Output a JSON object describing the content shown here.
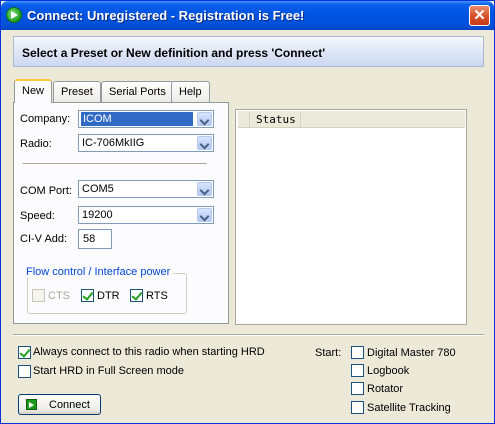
{
  "window": {
    "title": "Connect: Unregistered - Registration is Free!",
    "close_glyph": "✕",
    "icon": "green-arrow-icon"
  },
  "banner": {
    "text": "Select a Preset or New definition and press 'Connect'"
  },
  "tabs": [
    {
      "label": "New",
      "active": true
    },
    {
      "label": "Preset",
      "active": false
    },
    {
      "label": "Serial Ports",
      "active": false
    },
    {
      "label": "Help",
      "active": false
    }
  ],
  "form": {
    "company_label": "Company:",
    "company_value": "ICOM",
    "radio_label": "Radio:",
    "radio_value": "IC-706MkIIG",
    "com_port_label": "COM Port:",
    "com_port_value": "COM5",
    "speed_label": "Speed:",
    "speed_value": "19200",
    "civ_label": "CI-V Add:",
    "civ_value": "58"
  },
  "flow_control": {
    "title": "Flow control / Interface power",
    "cts": {
      "label": "CTS",
      "checked": false,
      "enabled": false
    },
    "dtr": {
      "label": "DTR",
      "checked": true,
      "enabled": true
    },
    "rts": {
      "label": "RTS",
      "checked": true,
      "enabled": true
    }
  },
  "status": {
    "column_header": "Status"
  },
  "options": {
    "always_connect": {
      "label": "Always connect to this radio when starting HRD",
      "checked": true
    },
    "full_screen": {
      "label": "Start HRD in Full Screen mode",
      "checked": false
    }
  },
  "start": {
    "label": "Start:",
    "items": [
      {
        "label": "Digital Master 780",
        "checked": false
      },
      {
        "label": "Logbook",
        "checked": false
      },
      {
        "label": "Rotator",
        "checked": false
      },
      {
        "label": "Satellite Tracking",
        "checked": false
      }
    ]
  },
  "connect_button": {
    "label": "Connect",
    "icon": "green-arrow-icon"
  },
  "colors": {
    "titlebar": "#0054e3",
    "accent_selection": "#316ac5",
    "group_title": "#0046d5",
    "check_mark": "#21a121"
  }
}
